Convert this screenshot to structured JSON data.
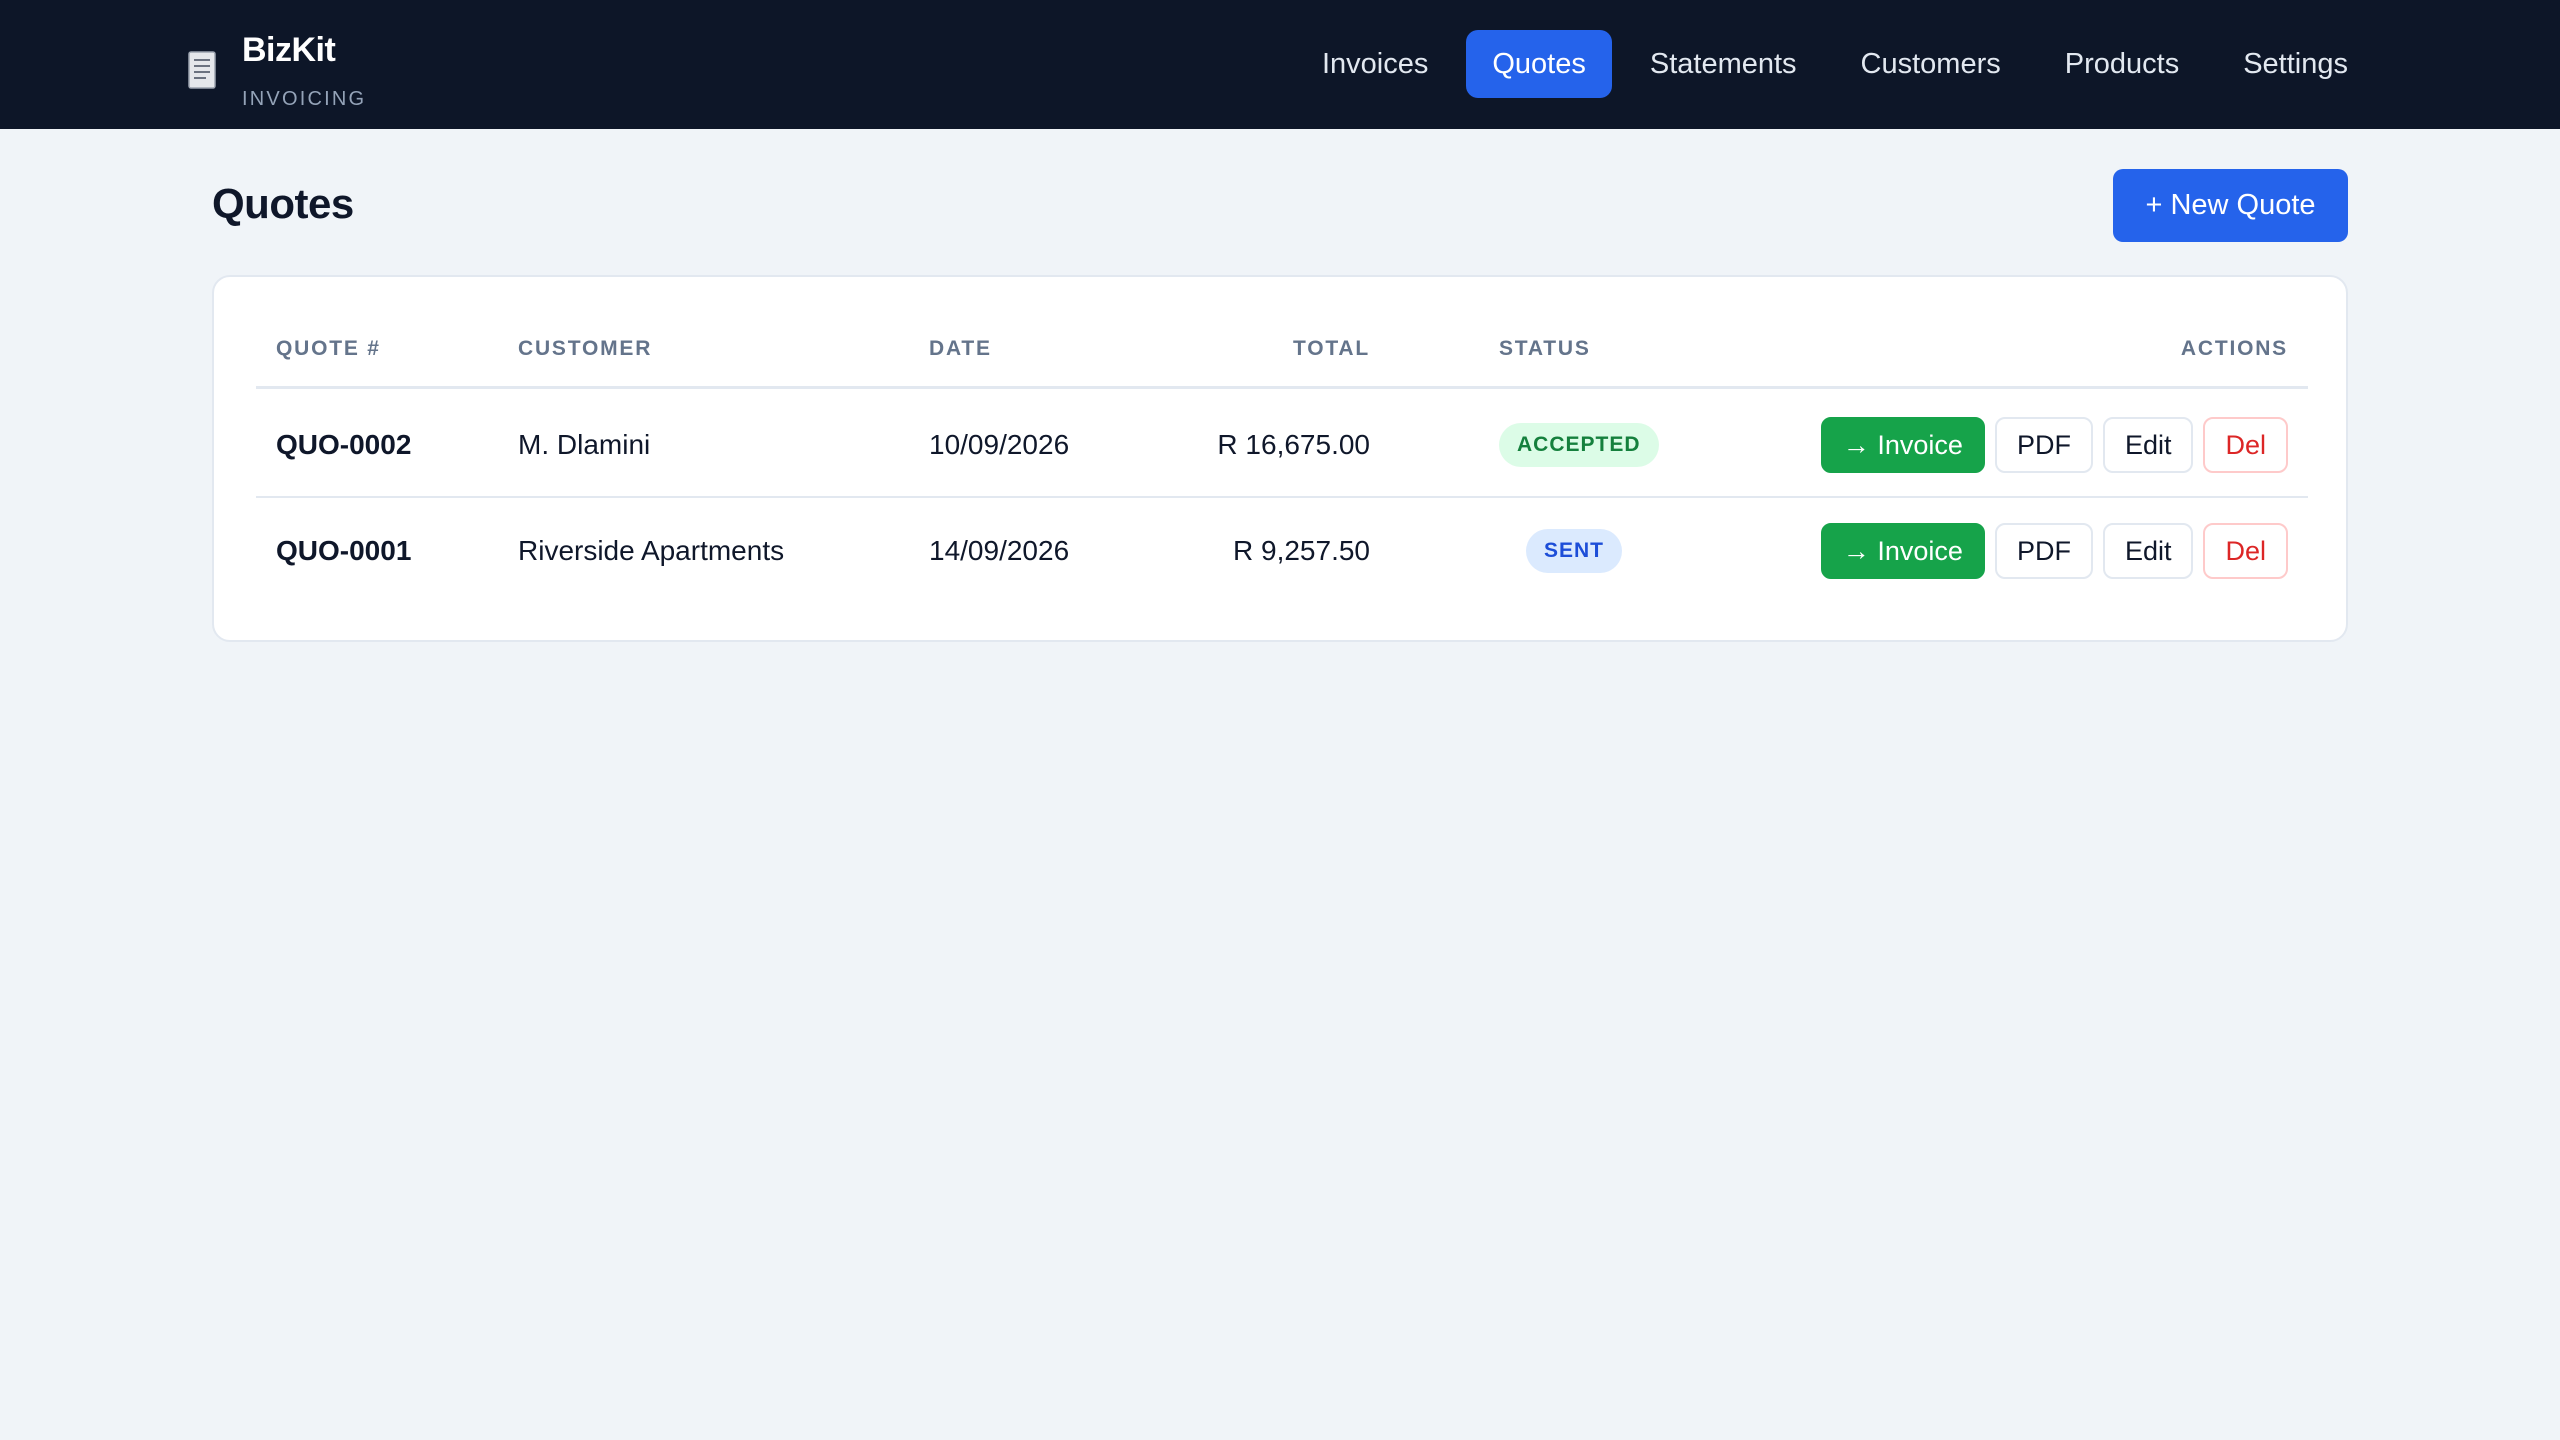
{
  "brand": {
    "name": "BizKit",
    "subtitle": "INVOICING",
    "icon": "receipt-icon"
  },
  "nav": [
    {
      "label": "Invoices",
      "active": false
    },
    {
      "label": "Quotes",
      "active": true
    },
    {
      "label": "Statements",
      "active": false
    },
    {
      "label": "Customers",
      "active": false
    },
    {
      "label": "Products",
      "active": false
    },
    {
      "label": "Settings",
      "active": false
    }
  ],
  "page": {
    "title": "Quotes",
    "new_button": "+ New Quote"
  },
  "table": {
    "headers": {
      "number": "QUOTE #",
      "customer": "CUSTOMER",
      "date": "DATE",
      "total": "TOTAL",
      "status": "STATUS",
      "actions": "ACTIONS"
    },
    "rows": [
      {
        "number": "QUO-0002",
        "customer": "M. Dlamini",
        "date": "10/09/2026",
        "total": "R 16,675.00",
        "status": "ACCEPTED"
      },
      {
        "number": "QUO-0001",
        "customer": "Riverside Apartments",
        "date": "14/09/2026",
        "total": "R 9,257.50",
        "status": "SENT"
      }
    ],
    "action_labels": {
      "invoice": "→ Invoice",
      "pdf": "PDF",
      "edit": "Edit",
      "delete": "Del"
    }
  },
  "colors": {
    "nav_bg": "#0d1628",
    "accent": "#2563eb",
    "success": "#16a34a",
    "danger": "#dc2626"
  }
}
